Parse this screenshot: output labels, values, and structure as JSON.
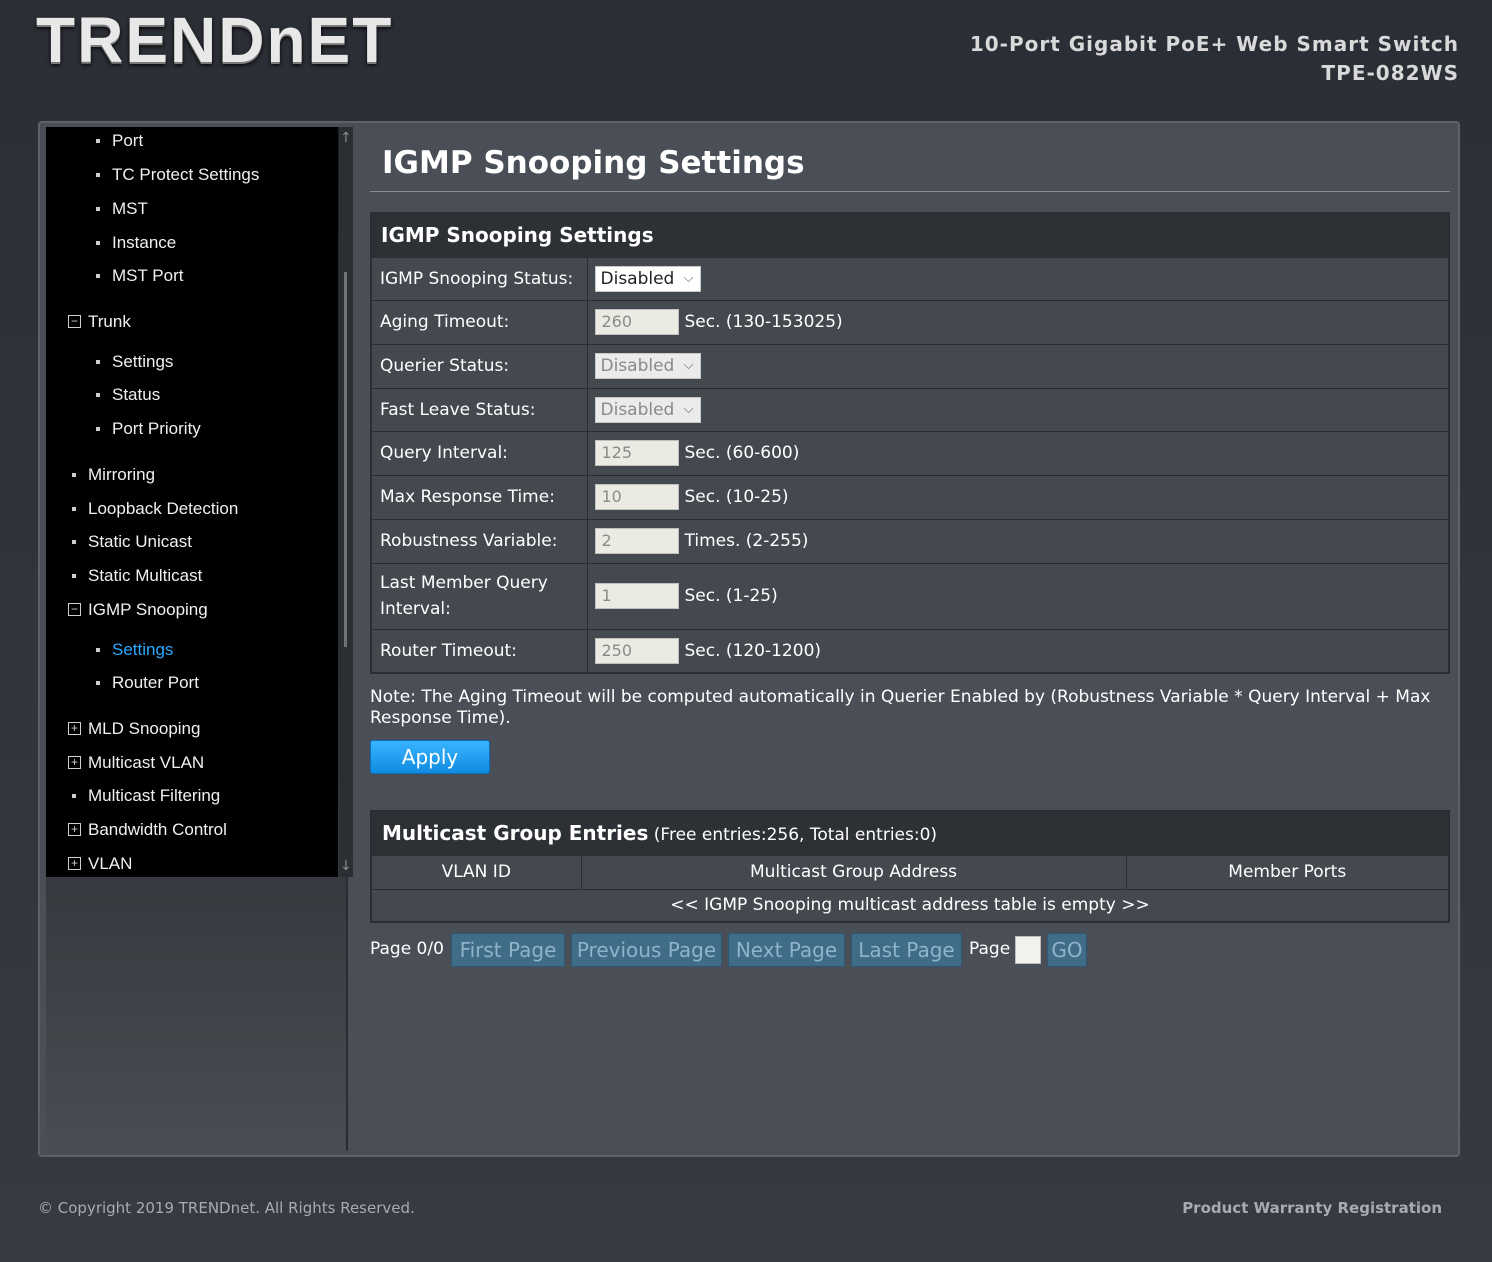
{
  "brand": {
    "logo_text": "TRENDnET",
    "product_line": "10-Port Gigabit PoE+ Web Smart Switch",
    "model": "TPE-082WS"
  },
  "sidebar": {
    "items": [
      {
        "label": "Port"
      },
      {
        "label": "TC Protect Settings"
      },
      {
        "label": "MST"
      },
      {
        "label": "Instance"
      },
      {
        "label": "MST Port"
      },
      {
        "label": "Trunk",
        "toggle": "−"
      },
      {
        "label": "Settings"
      },
      {
        "label": "Status"
      },
      {
        "label": "Port Priority"
      },
      {
        "label": "Mirroring"
      },
      {
        "label": "Loopback Detection"
      },
      {
        "label": "Static Unicast"
      },
      {
        "label": "Static Multicast"
      },
      {
        "label": "IGMP Snooping",
        "toggle": "−"
      },
      {
        "label": "Settings"
      },
      {
        "label": "Router Port"
      },
      {
        "label": "MLD Snooping",
        "toggle": "+"
      },
      {
        "label": "Multicast VLAN",
        "toggle": "+"
      },
      {
        "label": "Multicast Filtering"
      },
      {
        "label": "Bandwidth Control",
        "toggle": "+"
      },
      {
        "label": "VLAN",
        "toggle": "+"
      }
    ],
    "scroll_up": "↑",
    "scroll_down": "↓"
  },
  "page": {
    "title": "IGMP Snooping Settings"
  },
  "settings": {
    "header": "IGMP Snooping Settings",
    "snooping_status": {
      "label": "IGMP Snooping Status:",
      "value": "Disabled"
    },
    "aging_timeout": {
      "label": "Aging Timeout:",
      "value": "260",
      "hint": "Sec. (130-153025)"
    },
    "querier_status": {
      "label": "Querier Status:",
      "value": "Disabled"
    },
    "fast_leave_status": {
      "label": "Fast Leave Status:",
      "value": "Disabled"
    },
    "query_interval": {
      "label": "Query Interval:",
      "value": "125",
      "hint": "Sec. (60-600)"
    },
    "max_response_time": {
      "label": "Max Response Time:",
      "value": "10",
      "hint": "Sec. (10-25)"
    },
    "robustness_variable": {
      "label": "Robustness Variable:",
      "value": "2",
      "hint": "Times. (2-255)"
    },
    "last_member_query_interval": {
      "label_line1": "Last Member Query",
      "label_line2": "Interval:",
      "value": "1",
      "hint": "Sec. (1-25)"
    },
    "router_timeout": {
      "label": "Router Timeout:",
      "value": "250",
      "hint": "Sec. (120-1200)"
    },
    "note": "Note: The Aging Timeout will be computed automatically in Querier Enabled by (Robustness Variable * Query Interval + Max Response Time).",
    "apply_label": "Apply"
  },
  "multicast": {
    "title": "Multicast Group Entries",
    "summary": "(Free entries:256, Total entries:0)",
    "columns": [
      "VLAN ID",
      "Multicast Group Address",
      "Member Ports"
    ],
    "empty_text": "<< IGMP Snooping multicast address table is empty >>"
  },
  "pager": {
    "status": "Page 0/0",
    "first": "First Page",
    "previous": "Previous Page",
    "next": "Next Page",
    "last": "Last Page",
    "page_label": "Page",
    "go": "GO"
  },
  "footer": {
    "copyright": "© Copyright 2019 TRENDnet. All Rights Reserved.",
    "warranty": "Product Warranty Registration"
  }
}
